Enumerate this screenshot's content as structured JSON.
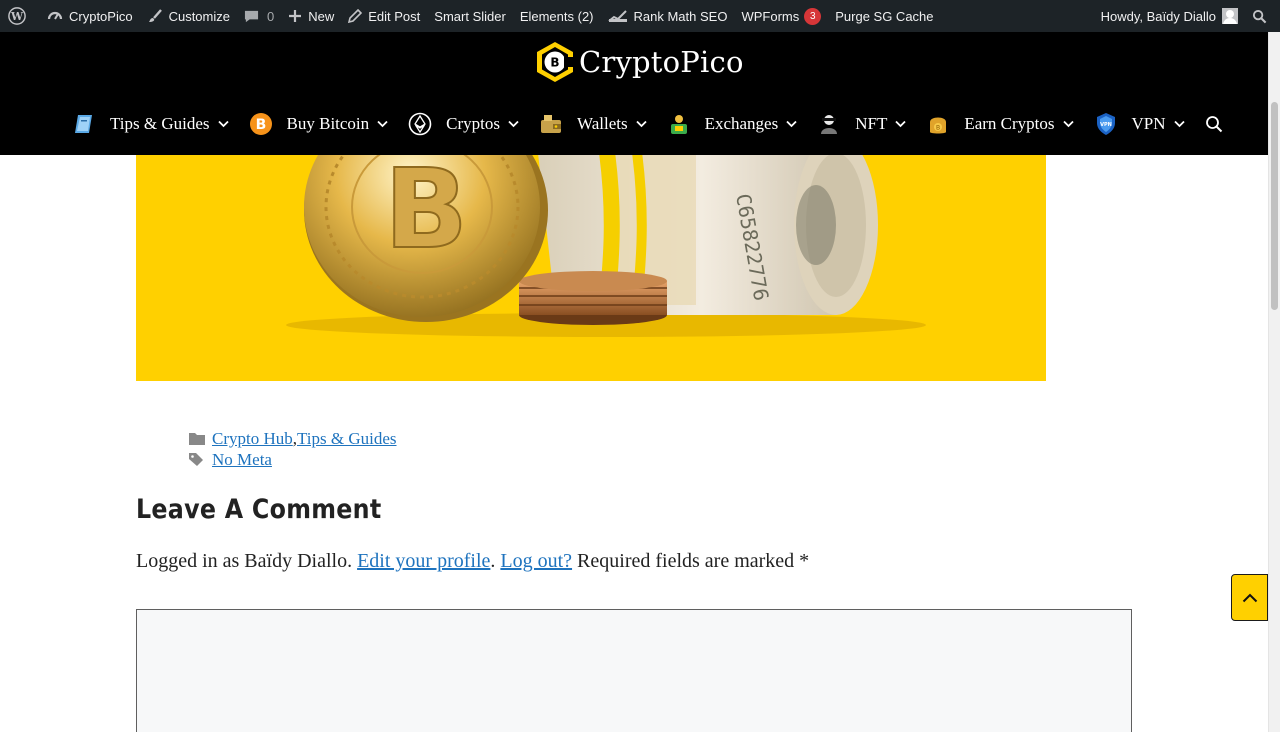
{
  "admin_bar": {
    "site": "CryptoPico",
    "customize": "Customize",
    "comments_count": "0",
    "new": "New",
    "edit_post": "Edit Post",
    "smart_slider": "Smart Slider",
    "elements": "Elements (2)",
    "rank_math": "Rank Math SEO",
    "wpforms": "WPForms",
    "wpforms_count": "3",
    "purge": "Purge SG Cache",
    "howdy": "Howdy, Baïdy Diallo"
  },
  "header": {
    "logo_text": "CryptoPico"
  },
  "nav": {
    "items": [
      {
        "label": "Tips & Guides",
        "icon": "guide-icon"
      },
      {
        "label": "Buy Bitcoin",
        "icon": "bitcoin-icon"
      },
      {
        "label": "Cryptos",
        "icon": "ethereum-icon"
      },
      {
        "label": "Wallets",
        "icon": "wallet-icon"
      },
      {
        "label": "Exchanges",
        "icon": "exchange-icon"
      },
      {
        "label": "NFT",
        "icon": "nft-icon"
      },
      {
        "label": "Earn Cryptos",
        "icon": "earn-icon"
      },
      {
        "label": "VPN",
        "icon": "vpn-shield-icon"
      }
    ]
  },
  "post_meta": {
    "categories": [
      "Crypto Hub",
      "Tips & Guides"
    ],
    "category_separator": ", ",
    "tag": "No Meta"
  },
  "comments": {
    "title": "Leave A Comment",
    "logged_prefix": "Logged in as Baïdy Diallo. ",
    "edit_profile": "Edit your profile",
    "separator": ". ",
    "log_out": "Log out?",
    "required_note": " Required fields are marked *"
  },
  "colors": {
    "accent_yellow": "#ffd000",
    "link_blue": "#1e73be",
    "admin_bar": "#1d2327",
    "header_bg": "#000000",
    "badge_red": "#d63638"
  }
}
